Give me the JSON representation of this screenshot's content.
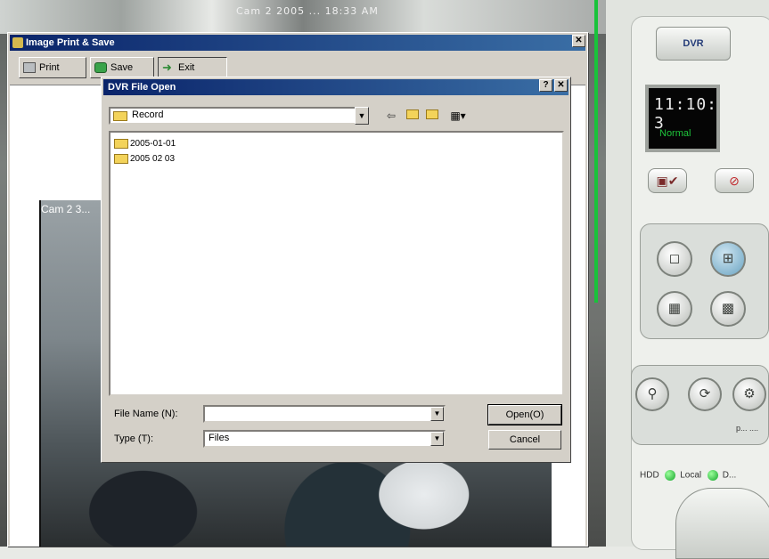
{
  "background": {
    "top_overlay_text": "Cam 2 2005 ... 18:33 AM",
    "camera_label": "Cam 2 3..."
  },
  "image_print_save": {
    "title": "Image Print & Save",
    "toolbar": {
      "print_label": "Print",
      "save_label": "Save",
      "exit_label": "Exit"
    }
  },
  "file_open": {
    "title": "DVR File Open",
    "look_in": "Record",
    "files": [
      {
        "name": "2005-01-01",
        "type": "folder"
      },
      {
        "name": "2005 02 03",
        "type": "folder"
      }
    ],
    "filename_label": "File Name (N):",
    "filename_value": "",
    "type_label": "Type (T):",
    "type_value": "Files",
    "open_label": "Open(O)",
    "cancel_label": "Cancel"
  },
  "dvr_panel": {
    "logo_text": "DVR",
    "clock_time": "11:10: 3",
    "clock_status": "Normal",
    "bottom_caption": "p... ....",
    "status": {
      "hdd_label": "HDD",
      "local_label": "Local",
      "remote_label": "D..."
    }
  }
}
